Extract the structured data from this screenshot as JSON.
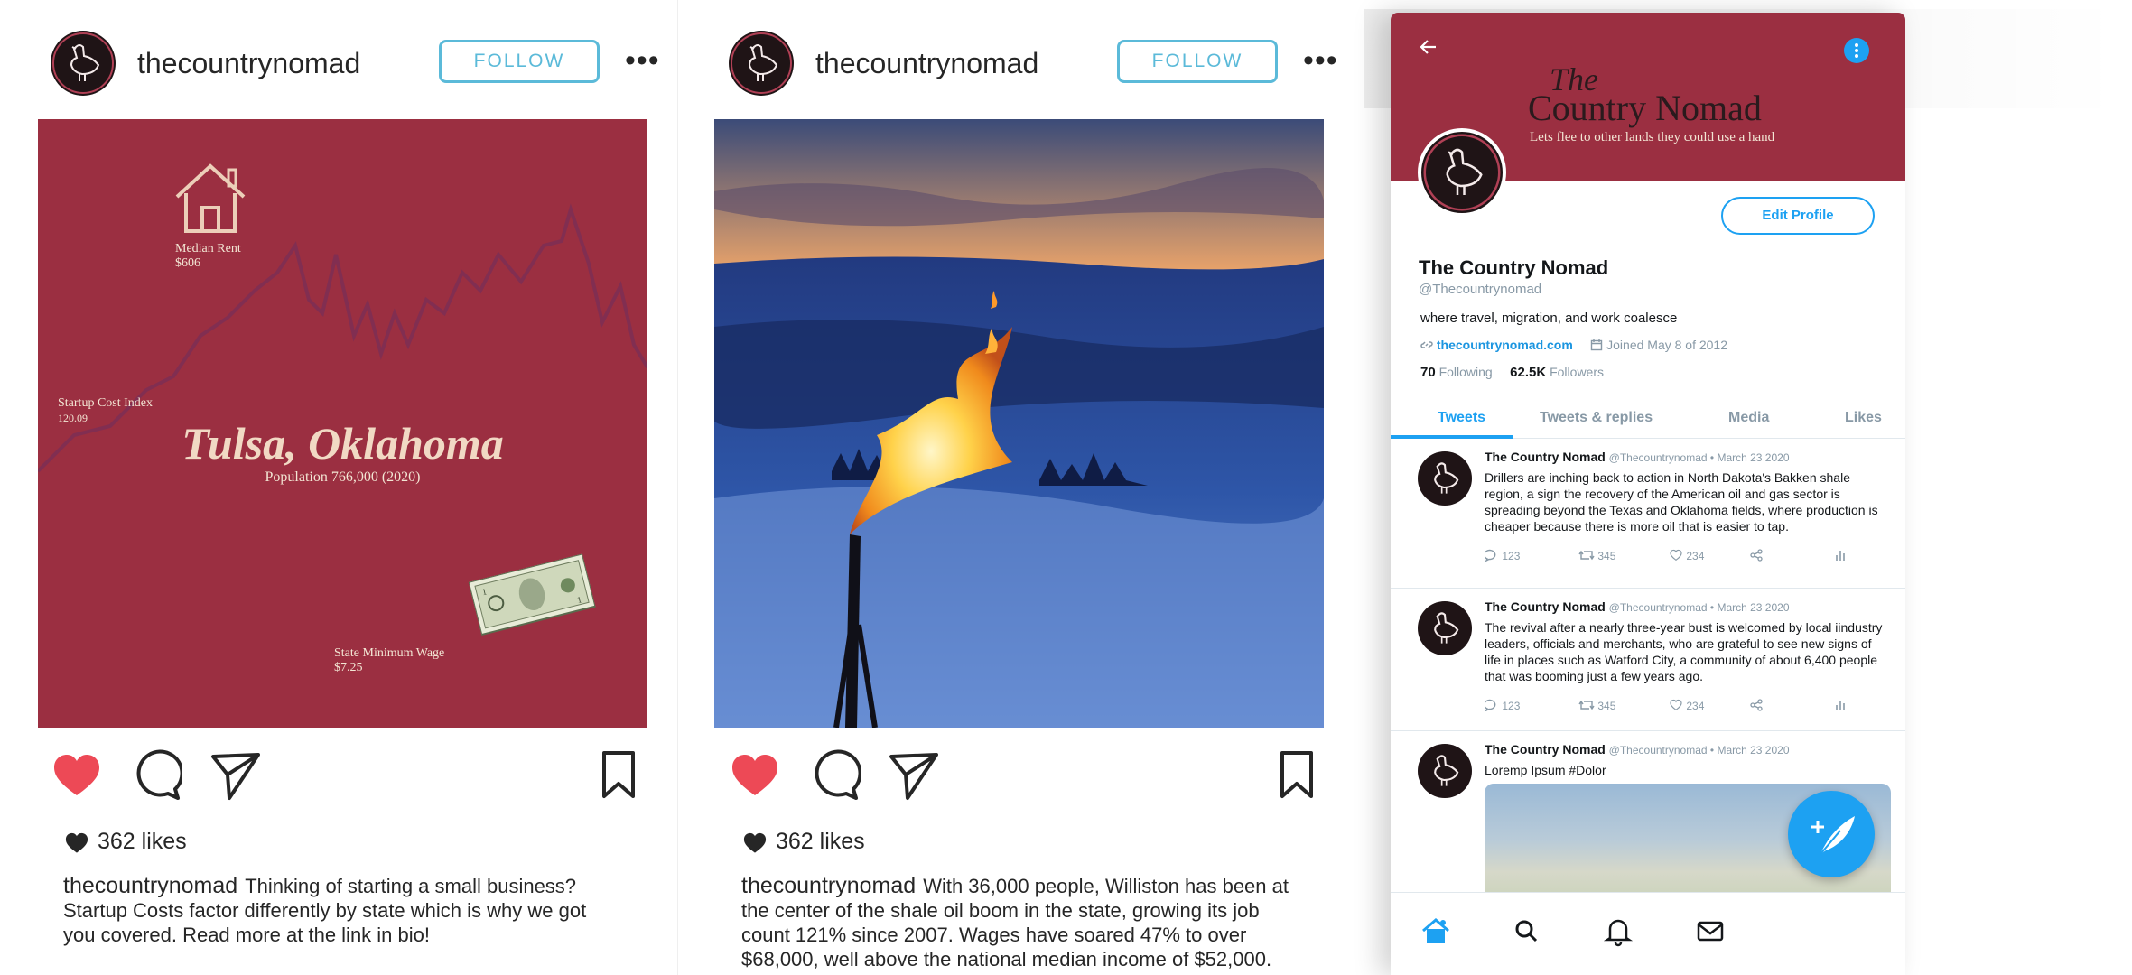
{
  "posts": [
    {
      "username": "thecountrynomad",
      "follow_label": "FOLLOW",
      "more_label": "•••",
      "likes": "362 likes",
      "caption_user": "thecountrynomad",
      "caption": "Thinking of starting a small business? Startup Costs factor differently by state which is why we got you covered. Read more at the link in bio!",
      "graphic": {
        "rent_label": "Median Rent",
        "rent_value": "$606",
        "index_label": "Startup Cost Index",
        "index_value": "120.09",
        "city": "Tulsa, Oklahoma",
        "population": "Population 766,000 (2020)",
        "wage_label": "State Minimum Wage",
        "wage_value": "$7.25"
      }
    },
    {
      "username": "thecountrynomad",
      "follow_label": "FOLLOW",
      "more_label": "•••",
      "likes": "362 likes",
      "caption_user": "thecountrynomad",
      "caption": "With 36,000 people, Williston has been at the center of the shale oil boom in the state, growing its job count 121% since 2007. Wages have soared 47% to over $68,000, well above the national median income of $52,000."
    }
  ],
  "twitter": {
    "banner_title_1": "The",
    "banner_title_2": "Country Nomad",
    "banner_tagline": "Lets flee to other lands they could use a hand",
    "edit_profile": "Edit Profile",
    "name": "The Country Nomad",
    "handle": "@Thecountrynomad",
    "bio": "where travel, migration, and work coalesce",
    "website": "thecountrynomad.com",
    "joined": "Joined May 8 of 2012",
    "following_count": "70",
    "following_label": "Following",
    "followers_count": "62.5K",
    "followers_label": "Followers",
    "tabs": [
      "Tweets",
      "Tweets & replies",
      "Media",
      "Likes"
    ],
    "tweets": [
      {
        "name": "The Country Nomad",
        "meta": "@Thecountrynomad • March 23 2020",
        "text": "Drillers are inching back to action in North Dakota's Bakken shale region, a sign the recovery of the American oil and gas sector is spreading beyond the Texas and Oklahoma fields, where production is cheaper because there is more oil that is easier to tap.",
        "replies": "123",
        "retweets": "345",
        "likes": "234"
      },
      {
        "name": "The Country Nomad",
        "meta": "@Thecountrynomad • March 23 2020",
        "text": "The revival after a nearly three-year bust is welcomed by local iindustry leaders, officials and merchants, who are grateful to see new signs of life in places such as Watford City, a community of about 6,400 people that was booming just a few years ago.",
        "replies": "123",
        "retweets": "345",
        "likes": "234"
      },
      {
        "name": "The Country Nomad",
        "meta": "@Thecountrynomad • March 23 2020",
        "text": "Loremp Ipsum #Dolor"
      }
    ]
  },
  "colors": {
    "brand_maroon": "#9b2f41",
    "twitter_blue": "#1da1f2",
    "like_red": "#ed4956",
    "follow_blue": "#5bbad9"
  }
}
